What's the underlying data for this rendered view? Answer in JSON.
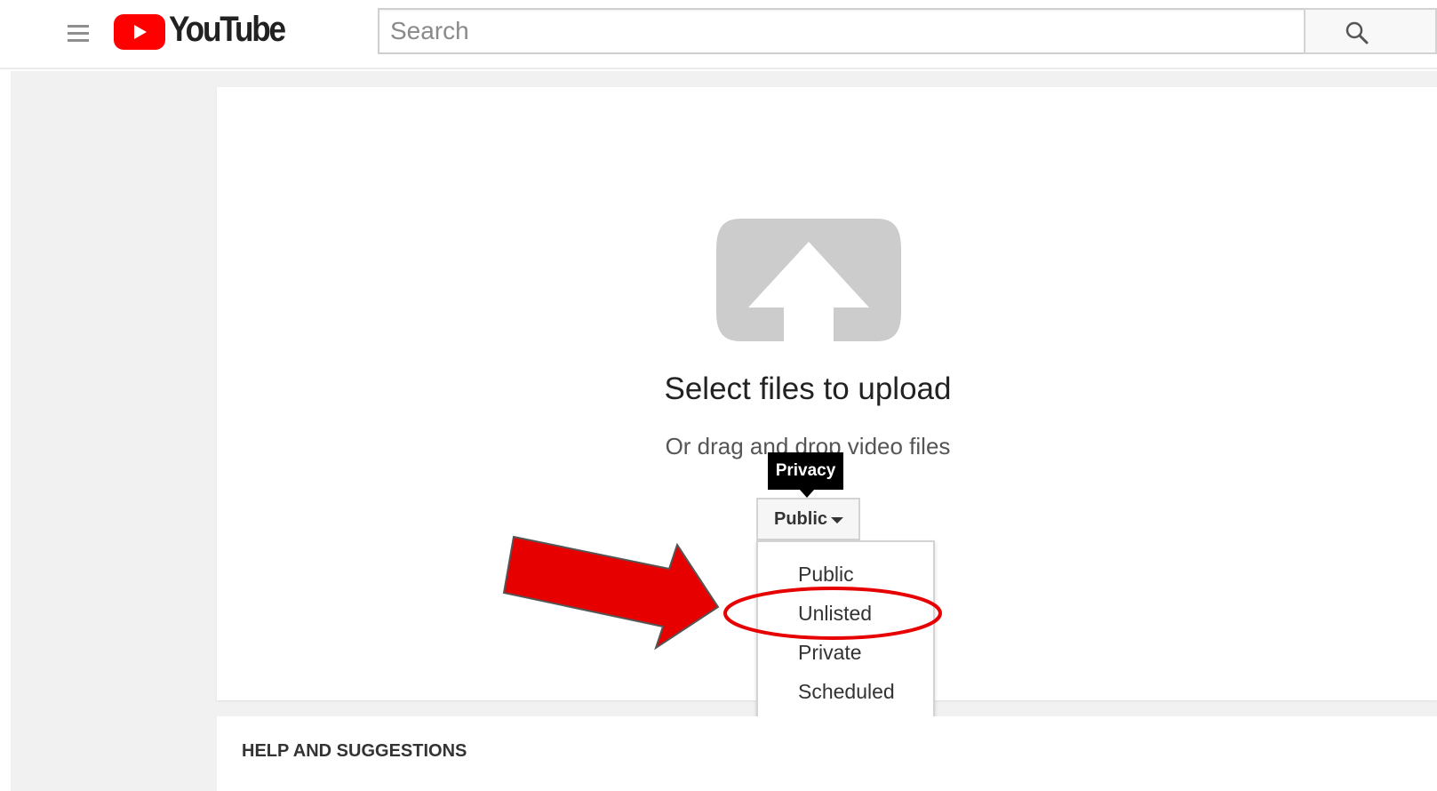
{
  "header": {
    "logo_text": "YouTube",
    "search_placeholder": "Search"
  },
  "upload": {
    "title": "Select files to upload",
    "subtitle": "Or drag and drop video files"
  },
  "privacy": {
    "tooltip": "Privacy",
    "selected": "Public",
    "options": [
      "Public",
      "Unlisted",
      "Private",
      "Scheduled"
    ]
  },
  "help": {
    "title": "HELP AND SUGGESTIONS"
  },
  "colors": {
    "brand_red": "#ff0000",
    "annotation_red": "#e60000",
    "upload_icon_gray": "#cccccc"
  },
  "annotations": {
    "arrow_points_to": "Unlisted",
    "circle_highlights": "Unlisted"
  }
}
